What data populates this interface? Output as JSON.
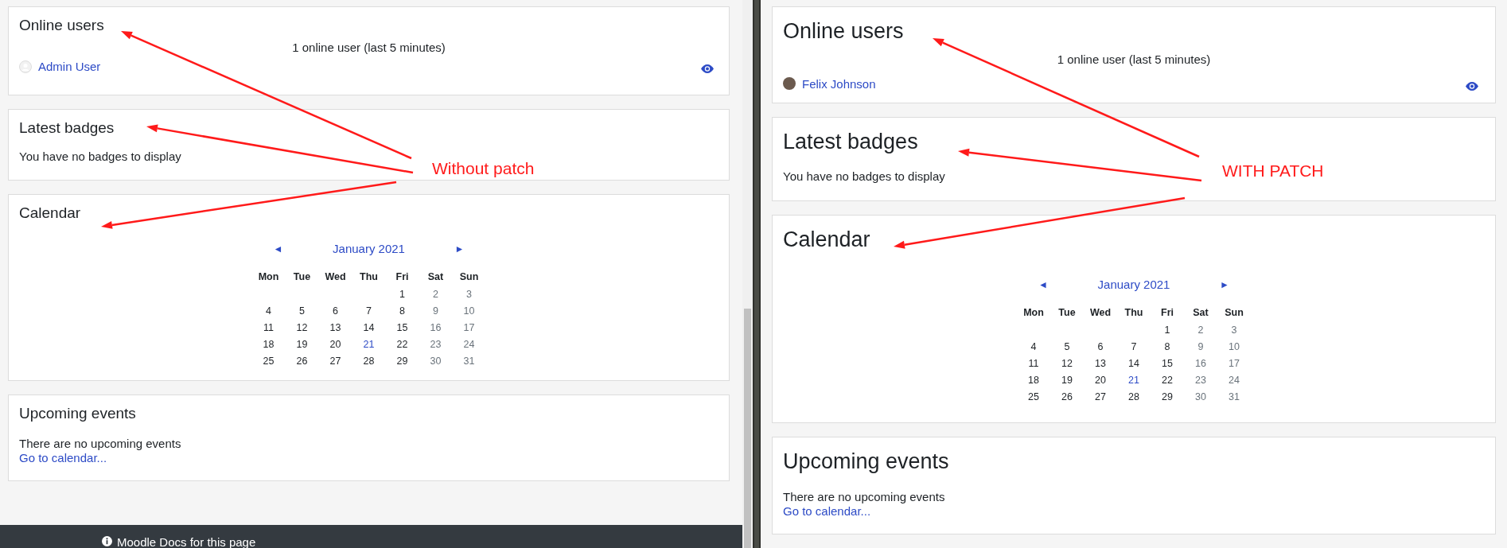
{
  "panes": [
    {
      "patched": false,
      "annotation": "Without patch",
      "online_users": {
        "title": "Online users",
        "summary": "1 online user (last 5 minutes)",
        "users": [
          {
            "name": "Admin User",
            "kind": "default"
          }
        ]
      },
      "badges": {
        "title": "Latest badges",
        "message": "You have no badges to display"
      },
      "calendar": {
        "title": "Calendar",
        "month": "January 2021",
        "prev": "◄",
        "next": "►",
        "weekdays": [
          "Mon",
          "Tue",
          "Wed",
          "Thu",
          "Fri",
          "Sat",
          "Sun"
        ],
        "weeks": [
          [
            {
              "kind": "blank"
            },
            {
              "kind": "blank"
            },
            {
              "kind": "blank"
            },
            {
              "kind": "blank"
            },
            {
              "day": "1",
              "kind": "weekday"
            },
            {
              "day": "2",
              "kind": "weekend"
            },
            {
              "day": "3",
              "kind": "weekend"
            }
          ],
          [
            {
              "day": "4",
              "kind": "weekday"
            },
            {
              "day": "5",
              "kind": "weekday"
            },
            {
              "day": "6",
              "kind": "weekday"
            },
            {
              "day": "7",
              "kind": "weekday"
            },
            {
              "day": "8",
              "kind": "weekday"
            },
            {
              "day": "9",
              "kind": "weekend"
            },
            {
              "day": "10",
              "kind": "weekend"
            }
          ],
          [
            {
              "day": "11",
              "kind": "weekday"
            },
            {
              "day": "12",
              "kind": "weekday"
            },
            {
              "day": "13",
              "kind": "weekday"
            },
            {
              "day": "14",
              "kind": "weekday"
            },
            {
              "day": "15",
              "kind": "weekday"
            },
            {
              "day": "16",
              "kind": "weekend"
            },
            {
              "day": "17",
              "kind": "weekend"
            }
          ],
          [
            {
              "day": "18",
              "kind": "weekday"
            },
            {
              "day": "19",
              "kind": "weekday"
            },
            {
              "day": "20",
              "kind": "weekday"
            },
            {
              "day": "21",
              "kind": "today"
            },
            {
              "day": "22",
              "kind": "weekday"
            },
            {
              "day": "23",
              "kind": "weekend"
            },
            {
              "day": "24",
              "kind": "weekend"
            }
          ],
          [
            {
              "day": "25",
              "kind": "weekday"
            },
            {
              "day": "26",
              "kind": "weekday"
            },
            {
              "day": "27",
              "kind": "weekday"
            },
            {
              "day": "28",
              "kind": "weekday"
            },
            {
              "day": "29",
              "kind": "weekday"
            },
            {
              "day": "30",
              "kind": "weekend"
            },
            {
              "day": "31",
              "kind": "weekend"
            }
          ]
        ]
      },
      "upcoming": {
        "title": "Upcoming events",
        "message": "There are no upcoming events",
        "link": "Go to calendar..."
      },
      "footer": {
        "link": "Moodle Docs for this page"
      }
    },
    {
      "patched": true,
      "annotation": "WITH PATCH",
      "online_users": {
        "title": "Online users",
        "summary": "1 online user (last 5 minutes)",
        "users": [
          {
            "name": "Felix Johnson",
            "kind": "photo"
          }
        ]
      },
      "badges": {
        "title": "Latest badges",
        "message": "You have no badges to display"
      },
      "calendar": {
        "title": "Calendar",
        "month": "January 2021",
        "prev": "◄",
        "next": "►",
        "weekdays": [
          "Mon",
          "Tue",
          "Wed",
          "Thu",
          "Fri",
          "Sat",
          "Sun"
        ],
        "weeks": [
          [
            {
              "kind": "blank"
            },
            {
              "kind": "blank"
            },
            {
              "kind": "blank"
            },
            {
              "kind": "blank"
            },
            {
              "day": "1",
              "kind": "weekday"
            },
            {
              "day": "2",
              "kind": "weekend"
            },
            {
              "day": "3",
              "kind": "weekend"
            }
          ],
          [
            {
              "day": "4",
              "kind": "weekday"
            },
            {
              "day": "5",
              "kind": "weekday"
            },
            {
              "day": "6",
              "kind": "weekday"
            },
            {
              "day": "7",
              "kind": "weekday"
            },
            {
              "day": "8",
              "kind": "weekday"
            },
            {
              "day": "9",
              "kind": "weekend"
            },
            {
              "day": "10",
              "kind": "weekend"
            }
          ],
          [
            {
              "day": "11",
              "kind": "weekday"
            },
            {
              "day": "12",
              "kind": "weekday"
            },
            {
              "day": "13",
              "kind": "weekday"
            },
            {
              "day": "14",
              "kind": "weekday"
            },
            {
              "day": "15",
              "kind": "weekday"
            },
            {
              "day": "16",
              "kind": "weekend"
            },
            {
              "day": "17",
              "kind": "weekend"
            }
          ],
          [
            {
              "day": "18",
              "kind": "weekday"
            },
            {
              "day": "19",
              "kind": "weekday"
            },
            {
              "day": "20",
              "kind": "weekday"
            },
            {
              "day": "21",
              "kind": "today"
            },
            {
              "day": "22",
              "kind": "weekday"
            },
            {
              "day": "23",
              "kind": "weekend"
            },
            {
              "day": "24",
              "kind": "weekend"
            }
          ],
          [
            {
              "day": "25",
              "kind": "weekday"
            },
            {
              "day": "26",
              "kind": "weekday"
            },
            {
              "day": "27",
              "kind": "weekday"
            },
            {
              "day": "28",
              "kind": "weekday"
            },
            {
              "day": "29",
              "kind": "weekday"
            },
            {
              "day": "30",
              "kind": "weekend"
            },
            {
              "day": "31",
              "kind": "weekend"
            }
          ]
        ]
      },
      "upcoming": {
        "title": "Upcoming events",
        "message": "There are no upcoming events",
        "link": "Go to calendar..."
      }
    }
  ]
}
